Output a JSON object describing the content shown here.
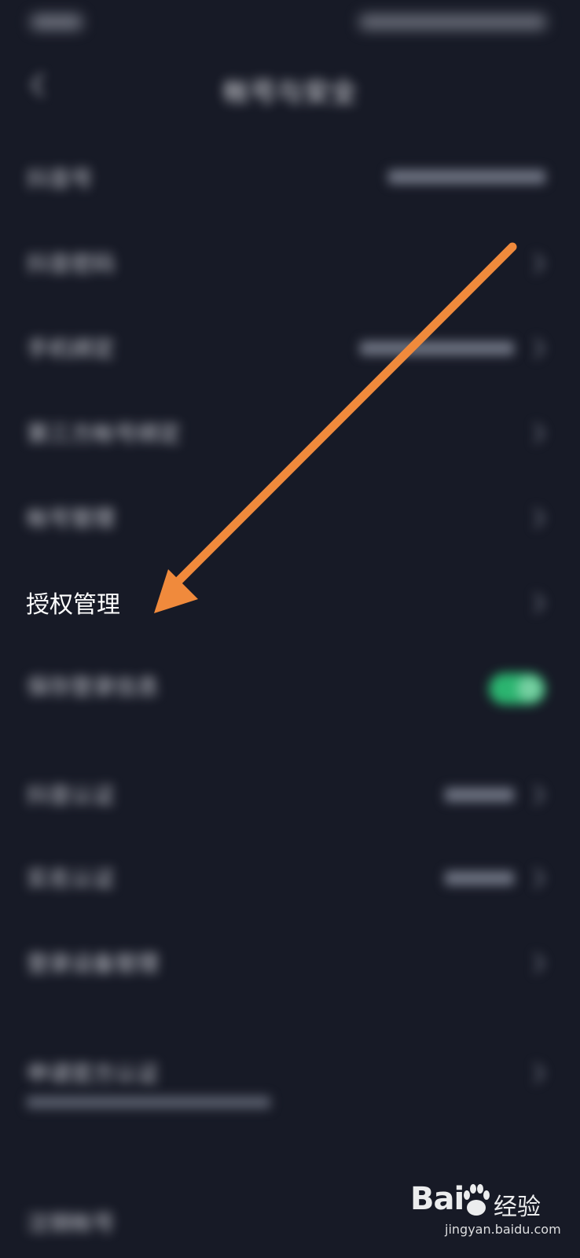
{
  "status_bar": {
    "time": "",
    "indicators": ""
  },
  "nav": {
    "title": "帐号与安全",
    "back_icon": "chevron-left-icon"
  },
  "rows": [
    {
      "label": "抖音号",
      "value": ""
    },
    {
      "label": "抖音密码"
    },
    {
      "label": "手机绑定",
      "value": ""
    },
    {
      "label": "第三方帐号绑定"
    },
    {
      "label": "帐号管理"
    },
    {
      "label": "授权管理"
    },
    {
      "label": "保存登录信息",
      "toggle_on": true
    },
    {
      "label": "抖音认证",
      "value": ""
    },
    {
      "label": "实名认证",
      "value": ""
    },
    {
      "label": "登录设备管理"
    },
    {
      "label": "申请官方认证",
      "sub": ""
    },
    {
      "label": "注销帐号"
    }
  ],
  "annotation": {
    "color": "#f08a3c"
  },
  "watermark": {
    "logo": "Bai du 经验",
    "sub": "jingyan.baidu.com"
  }
}
